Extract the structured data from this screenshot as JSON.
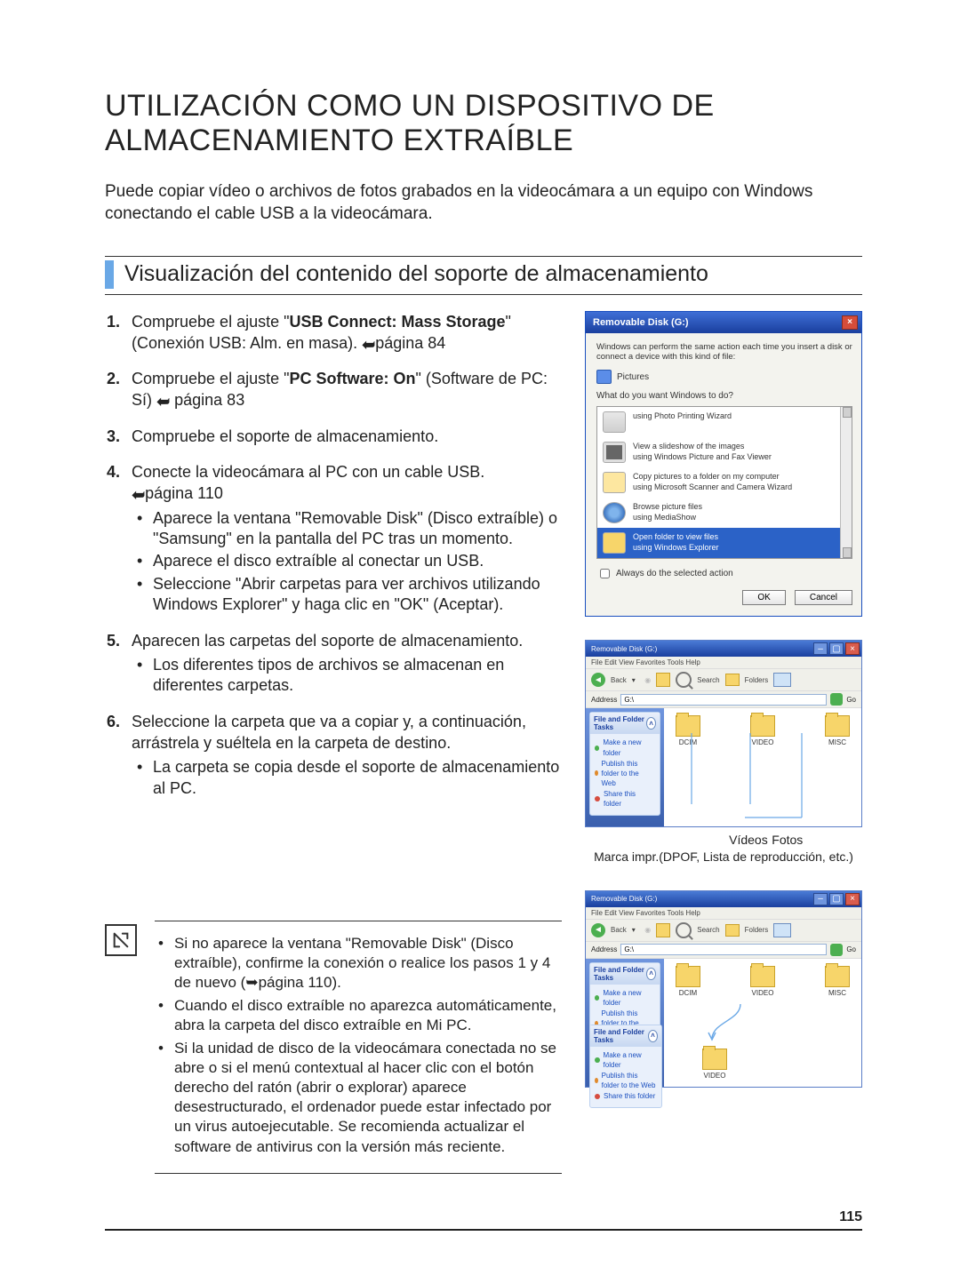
{
  "title": "UTILIZACIÓN COMO UN DISPOSITIVO DE ALMACENAMIENTO EXTRAÍBLE",
  "intro": "Puede copiar vídeo o archivos de fotos grabados en la videocámara a un equipo con Windows conectando el cable USB a la videocámara.",
  "section_heading": "Visualización del contenido del soporte de almacenamiento",
  "steps": [
    {
      "text_before": "Compruebe el ajuste \"",
      "bold1": "USB Connect: Mass Storage",
      "text_after": "\" (Conexión USB: Alm. en masa). ",
      "page_ref": "página 84"
    },
    {
      "text_before": "Compruebe el ajuste \"",
      "bold1": "PC Software: On",
      "text_after": "\" (Software de PC: Sí) ",
      "page_ref": "página 83"
    },
    {
      "text_before": "Compruebe el soporte de almacenamiento."
    },
    {
      "text_before": "Conecte la videocámara al PC con un cable USB.",
      "page_ref": "página 110",
      "sub": [
        "Aparece la ventana \"Removable Disk\" (Disco extraíble) o \"Samsung\" en la pantalla del PC tras un momento.",
        "Aparece el disco extraíble al conectar un USB.",
        "Seleccione \"Abrir carpetas para ver archivos utilizando Windows Explorer\" y haga clic en \"OK\" (Aceptar)."
      ]
    },
    {
      "text_before": "Aparecen las carpetas del soporte de almacenamiento.",
      "sub": [
        "Los diferentes tipos de archivos se almacenan en diferentes carpetas."
      ]
    },
    {
      "text_before": "Seleccione la carpeta que va a copiar y, a continuación, arrástrela y suéltela en la carpeta de destino.",
      "sub": [
        "La carpeta se copia desde el soporte de almacenamiento al PC."
      ]
    }
  ],
  "dialog": {
    "title": "Removable Disk (G:)",
    "intro": "Windows can perform the same action each time you insert a disk or connect a device with this kind of file:",
    "media_type": "Pictures",
    "question": "What do you want Windows to do?",
    "options": [
      {
        "title": "using Photo Printing Wizard",
        "sub": "",
        "sel": false,
        "ico": "printer"
      },
      {
        "title": "View a slideshow of the images",
        "sub": "using Windows Picture and Fax Viewer",
        "sel": false,
        "ico": "film"
      },
      {
        "title": "Copy pictures to a folder on my computer",
        "sub": "using Microsoft Scanner and Camera Wizard",
        "sel": false,
        "ico": "copy"
      },
      {
        "title": "Browse picture files",
        "sub": "using MediaShow",
        "sel": false,
        "ico": "media"
      },
      {
        "title": "Open folder to view files",
        "sub": "using Windows Explorer",
        "sel": true,
        "ico": "folder"
      }
    ],
    "always": "Always do the selected action",
    "ok": "OK",
    "cancel": "Cancel"
  },
  "explorer": {
    "title": "Removable Disk (G:)",
    "menu": "File   Edit   View   Favorites   Tools   Help",
    "back": "Back",
    "search": "Search",
    "folders": "Folders",
    "address_label": "Address",
    "address_value": "G:\\",
    "go": "Go",
    "side_title": "File and Folder Tasks",
    "side_links": [
      "Make a new folder",
      "Publish this folder to the Web",
      "Share this folder"
    ],
    "root_folders": [
      "DCIM",
      "VIDEO",
      "MISC"
    ],
    "video_folder": "VIDEO",
    "captions": {
      "fotos": "Fotos",
      "videos": "Vídeos",
      "misc": "Marca impr.(DPOF, Lista de reproducción, etc.)"
    }
  },
  "notes": [
    "Si no aparece la ventana \"Removable Disk\" (Disco extraíble), confirme la conexión o realice los pasos 1 y 4 de nuevo (➥página 110).",
    "Cuando el disco extraíble no aparezca automáticamente, abra la carpeta del disco extraíble en Mi PC.",
    "Si la unidad de disco de la videocámara conectada no se abre o si el menú contextual al hacer clic con el botón derecho del ratón (abrir o explorar) aparece desestructurado, el ordenador puede estar infectado por un virus autoejecutable. Se recomienda actualizar el software de antivirus con la versión más reciente."
  ],
  "page_number": "115"
}
